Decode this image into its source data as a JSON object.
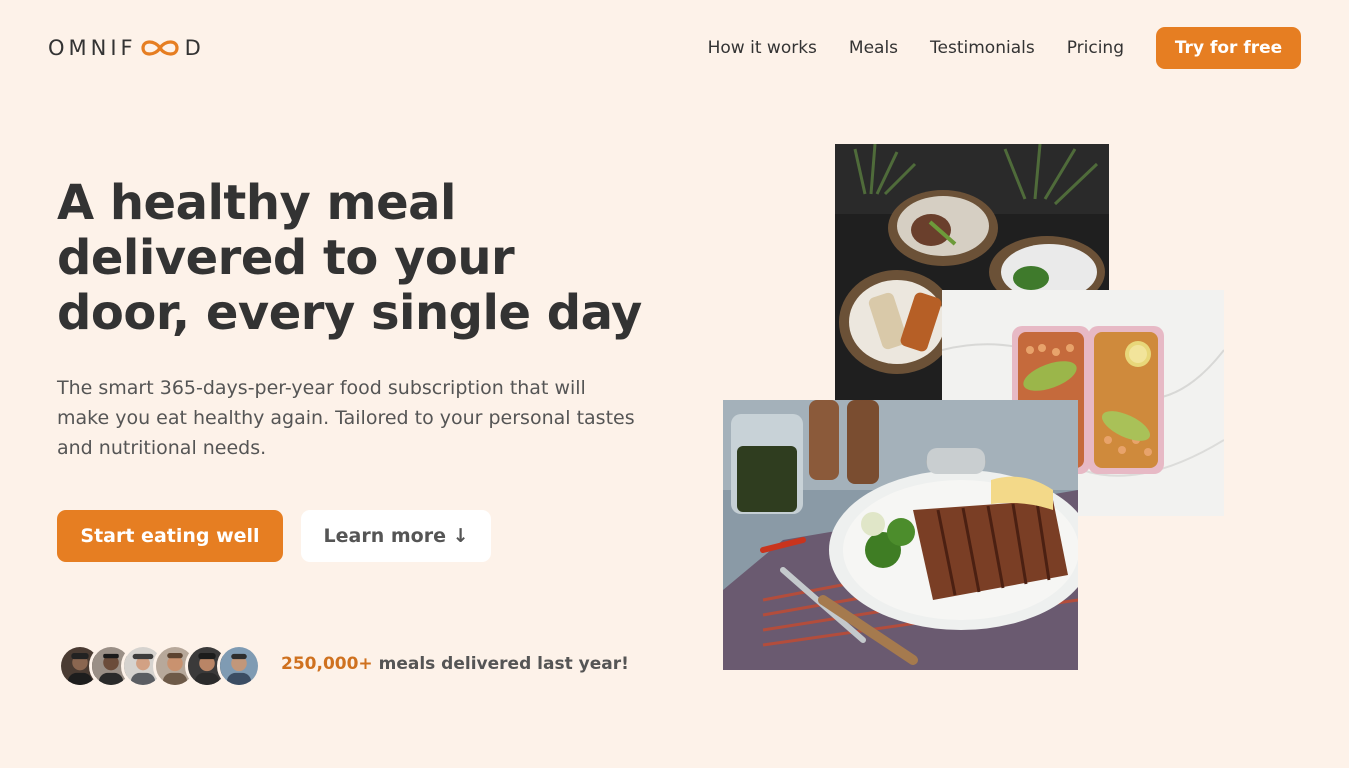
{
  "header": {
    "logo_text_left": "OMNIF",
    "logo_text_right": "D",
    "logo_mark": "infinity-logo-icon",
    "nav": [
      {
        "label": "How it works"
      },
      {
        "label": "Meals"
      },
      {
        "label": "Testimonials"
      },
      {
        "label": "Pricing"
      }
    ],
    "cta_label": "Try for free"
  },
  "hero": {
    "title": "A healthy meal delivered to your door, every single day",
    "description": "The smart 365-days-per-year food subscription that will make you eat healthy again. Tailored to your personal tastes and nutritional needs.",
    "primary_button": "Start eating well",
    "secondary_button": "Learn more ↓",
    "delivered_count": "250,000+",
    "delivered_text": " meals delivered last year!"
  },
  "colors": {
    "background": "#fdf2e9",
    "accent": "#e67e22",
    "accent_dark": "#cf711f",
    "text": "#333333"
  }
}
